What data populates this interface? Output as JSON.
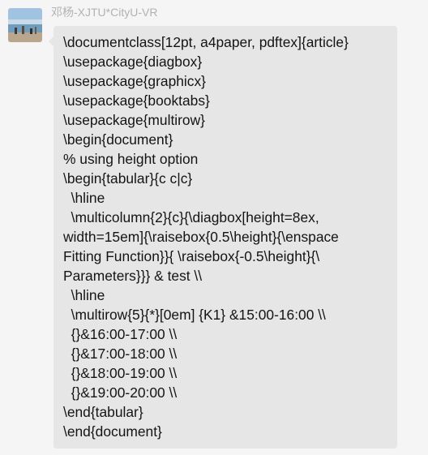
{
  "chat": {
    "sender_name": "邓杨-XJTU*CityU-VR",
    "avatar_icon": "avatar-beach-photo",
    "message_lines": [
      "\\documentclass[12pt, a4paper, pdftex]{article}",
      "\\usepackage{diagbox}",
      "\\usepackage{graphicx}",
      "\\usepackage{booktabs}",
      "\\usepackage{multirow}",
      "\\begin{document}",
      "% using height option",
      "\\begin{tabular}{c c|c}",
      "  \\hline",
      "  \\multicolumn{2}{c}{\\diagbox[height=8ex,",
      "width=15em]{\\raisebox{0.5\\height}{\\enspace",
      "Fitting Function}}{ \\raisebox{-0.5\\height}{\\",
      "Parameters}}} & test \\\\",
      "  \\hline",
      "  \\multirow{5}{*}[0em] {K1} &15:00-16:00 \\\\",
      "  {}&16:00-17:00 \\\\",
      "  {}&17:00-18:00 \\\\",
      "  {}&18:00-19:00 \\\\",
      "  {}&19:00-20:00 \\\\",
      "\\end{tabular}",
      "\\end{document}"
    ]
  },
  "colors": {
    "background": "#f5f5f5",
    "bubble": "#e6e6e6",
    "sender_name": "#b2b2b2",
    "message_text": "#141414"
  }
}
